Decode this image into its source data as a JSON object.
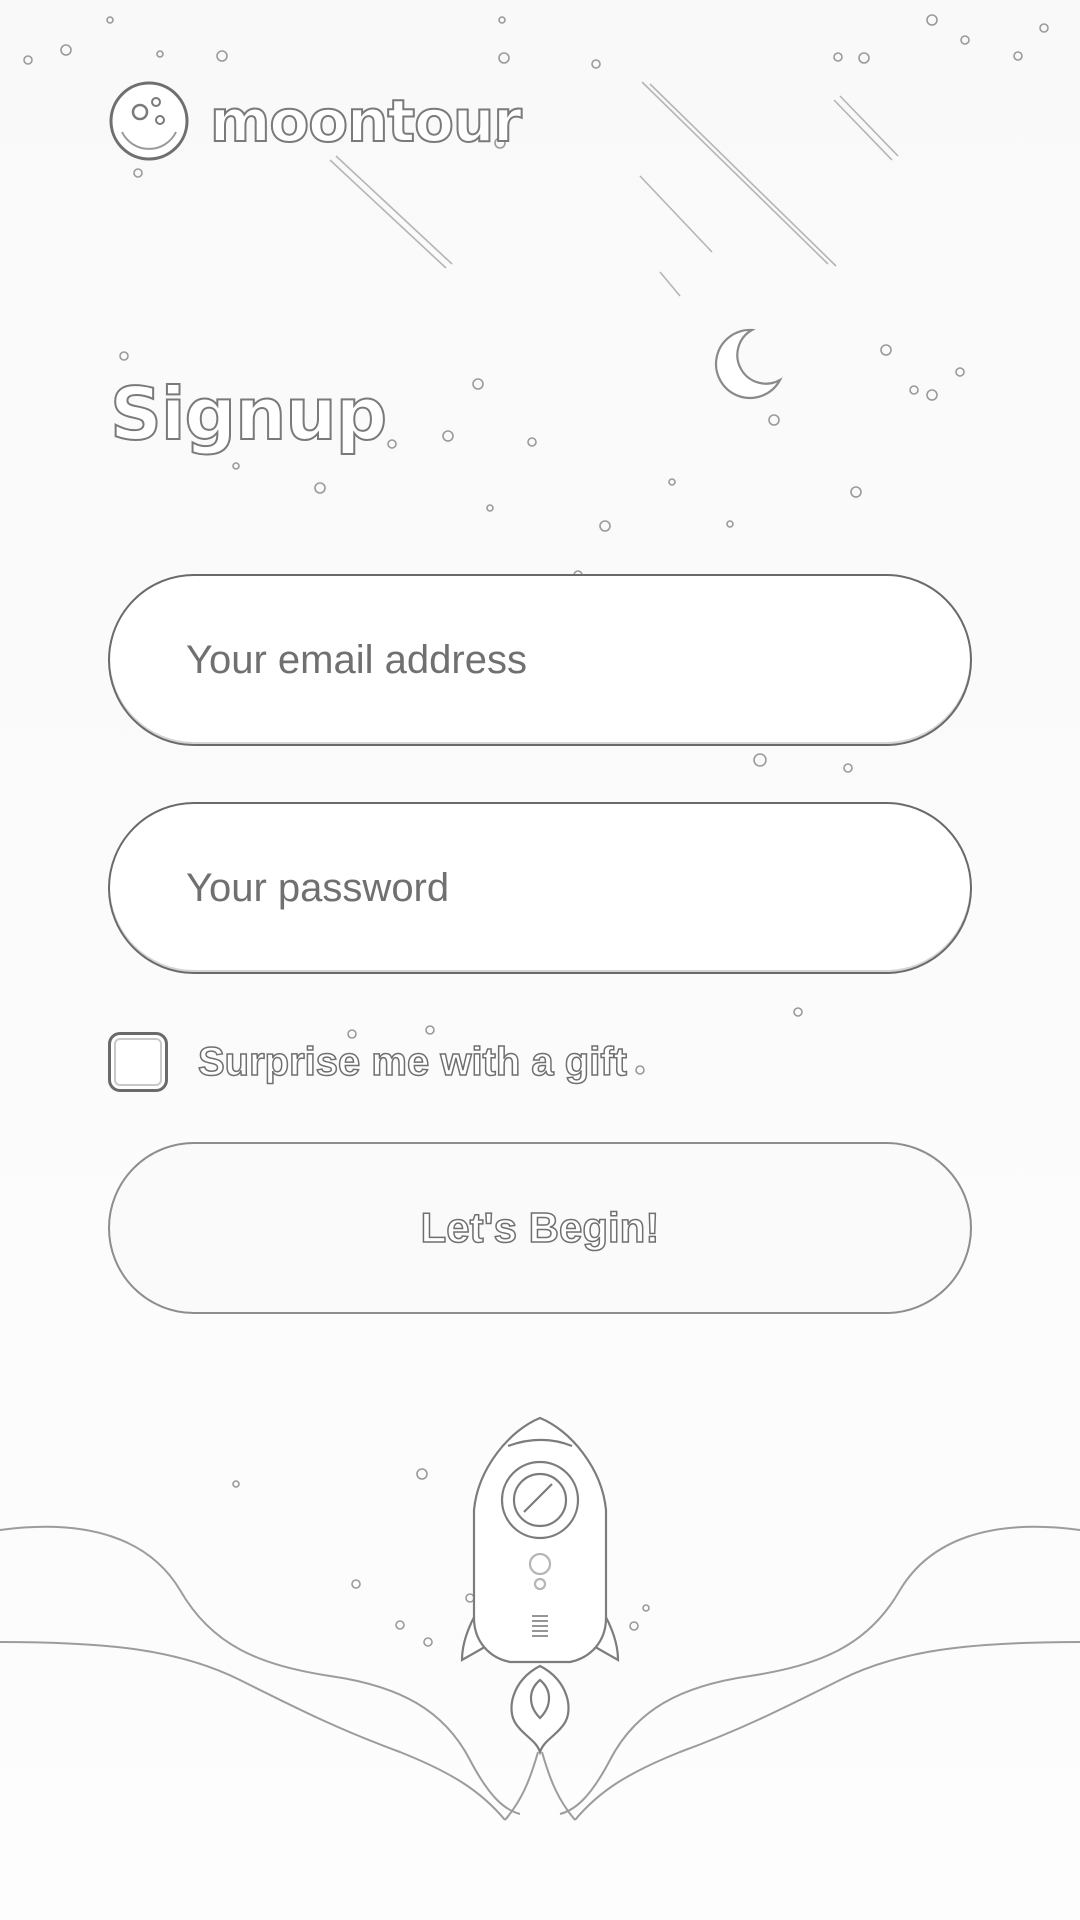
{
  "brand": {
    "name": "moontour",
    "logo_icon": "moon-logo-icon"
  },
  "page": {
    "title": "Signup"
  },
  "form": {
    "email_placeholder": "Your email address",
    "email_value": "",
    "password_placeholder": "Your password",
    "password_value": "",
    "gift_checkbox_label": "Surprise me with a gift",
    "gift_checked": false,
    "submit_label": "Let's Begin!"
  },
  "decor": {
    "moon": "crescent-moon-icon",
    "rocket": "rocket-icon",
    "clouds": "cloud-waves"
  },
  "colors": {
    "outline": "#6a6a6a",
    "background": "#f9f9f9",
    "field_fill": "#ffffff"
  }
}
